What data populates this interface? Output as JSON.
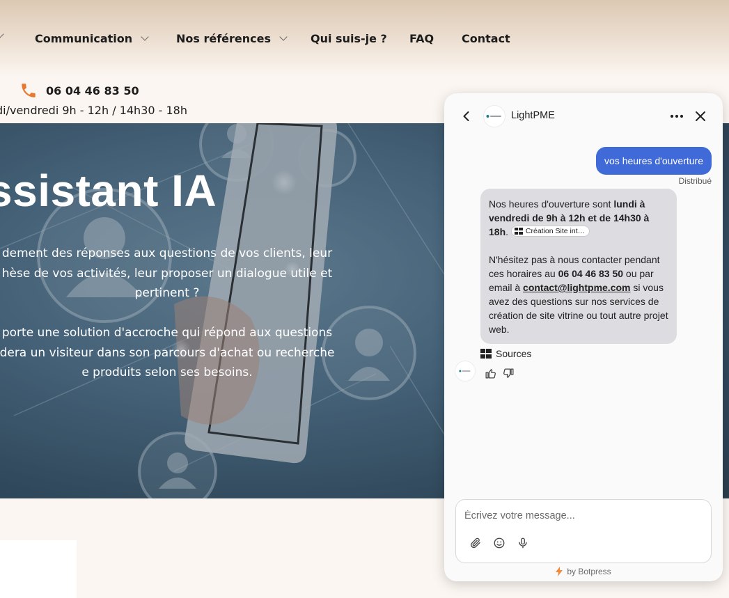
{
  "nav": {
    "items": [
      {
        "label": "Communication",
        "has_dropdown": true
      },
      {
        "label": "Nos références",
        "has_dropdown": true
      },
      {
        "label": "Qui suis-je ?",
        "has_dropdown": false
      },
      {
        "label": "FAQ",
        "has_dropdown": false
      },
      {
        "label": "Contact",
        "has_dropdown": false
      }
    ]
  },
  "contact_bar": {
    "phone": "06 04 46 83 50",
    "hours": "di/vendredi 9h - 12h / 14h30 - 18h",
    "phone_icon": "phone-icon",
    "accent_color": "#e8782f"
  },
  "hero": {
    "title": "ssistant IA",
    "para1": [
      "dement des réponses aux questions de vos clients, leur",
      "hèse de vos activités, leur proposer un dialogue utile et",
      "pertinent ?"
    ],
    "para2": [
      "porte une solution d'accroche qui répond aux questions",
      "dera un visiteur dans son parcours d'achat ou recherche",
      "e produits selon ses besoins."
    ]
  },
  "chat": {
    "bot_name": "LightPME",
    "user_message": "vos heures d'ouverture",
    "status": "Distribué",
    "reply": {
      "intro": "Nos heures d'ouverture sont ",
      "hours_bold": "lundi à vendredi de 9h à 12h et de 14h30 à 18h",
      "period": ".",
      "source_chip": "Création Site int…",
      "line2_a": "N'hésitez pas à nous contacter pendant ces horaires au ",
      "phone_bold": "06 04 46 83 50",
      "line2_b": " ou par email à ",
      "email": "contact@lightpme.com",
      "line2_c": " si vous avez des questions sur nos services de création de site vitrine ou tout autre projet web."
    },
    "sources_label": "Sources",
    "input_placeholder": "Écrivez votre message...",
    "powered_by": "by Botpress",
    "user_bubble_color": "#3f6ad8",
    "bot_bubble_color": "#dcdce1",
    "icons": [
      "back-icon",
      "more-icon",
      "close-icon",
      "thumbs-up-icon",
      "thumbs-down-icon",
      "attach-icon",
      "emoji-icon",
      "microphone-icon",
      "bolt-icon"
    ]
  }
}
